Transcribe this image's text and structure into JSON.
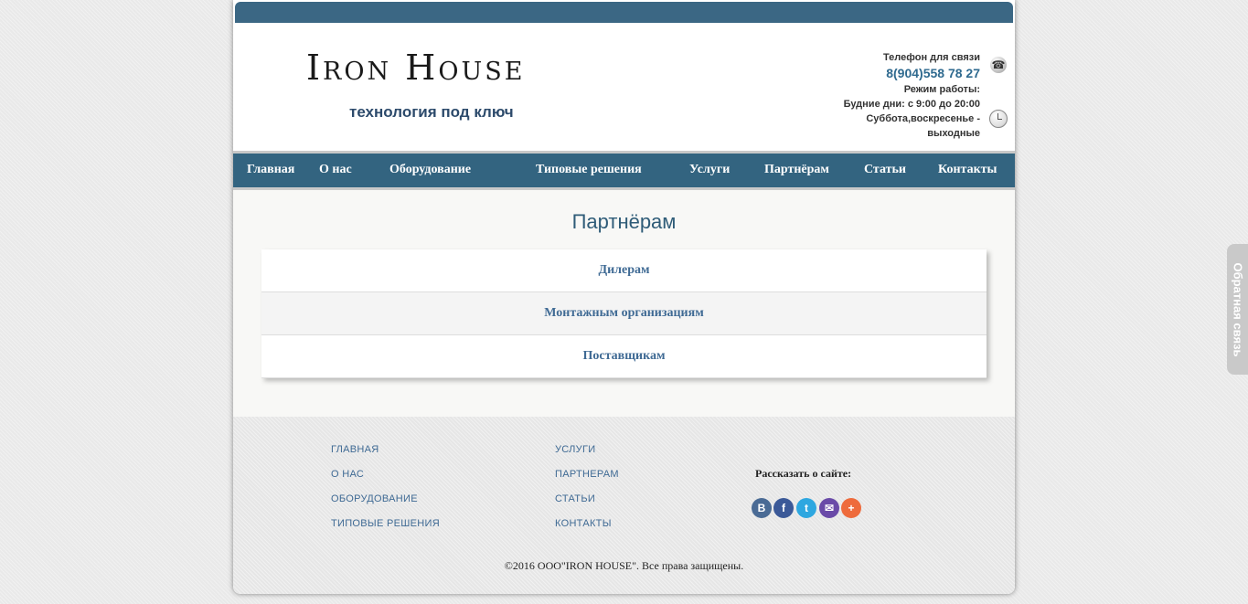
{
  "header": {
    "logo_title": "Iron House",
    "logo_tagline": "технология под ключ",
    "contact": {
      "phone_label": "Телефон для связи",
      "phone_number": "8(904)558 78 27",
      "hours_label": "Режим работы:",
      "weekdays": "Будние дни: с 9:00 до 20:00",
      "weekend": "Суббота,воскресенье - выходные"
    }
  },
  "nav": {
    "items": [
      {
        "label": "Главная"
      },
      {
        "label": "О нас"
      },
      {
        "label": "Оборудование"
      },
      {
        "label": "Типовые решения"
      },
      {
        "label": "Услуги"
      },
      {
        "label": "Партнёрам"
      },
      {
        "label": "Статьи"
      },
      {
        "label": "Контакты"
      }
    ]
  },
  "main": {
    "title": "Партнёрам",
    "partners": [
      {
        "label": "Дилерам"
      },
      {
        "label": "Монтажным организациям"
      },
      {
        "label": "Поставщикам"
      }
    ]
  },
  "footer": {
    "links_col1": [
      {
        "label": "ГЛАВНАЯ"
      },
      {
        "label": "О НАС"
      },
      {
        "label": "ОБОРУДОВАНИЕ"
      },
      {
        "label": "ТИПОВЫЕ РЕШЕНИЯ"
      }
    ],
    "links_col2": [
      {
        "label": "УСЛУГИ"
      },
      {
        "label": "ПАРТНЕРАМ"
      },
      {
        "label": "СТАТЬИ"
      },
      {
        "label": "КОНТАКТЫ"
      }
    ],
    "share_label": "Рассказать о сайте:",
    "social": [
      {
        "icon": "vk-icon",
        "glyph": "В",
        "color": "#4a6b95"
      },
      {
        "icon": "facebook-icon",
        "glyph": "f",
        "color": "#3b5998"
      },
      {
        "icon": "twitter-icon",
        "glyph": "t",
        "color": "#2ea7e0"
      },
      {
        "icon": "mail-icon",
        "glyph": "✉",
        "color": "#6a4aa8"
      },
      {
        "icon": "more-icon",
        "glyph": "+",
        "color": "#ee6b3c"
      }
    ],
    "copyright": "©2016 ООО\"IRON HOUSE\". Все права защищены."
  },
  "feedback_tab": "Обратная связь",
  "colors": {
    "brand_blue": "#336480",
    "link_blue": "#3f6a94"
  }
}
